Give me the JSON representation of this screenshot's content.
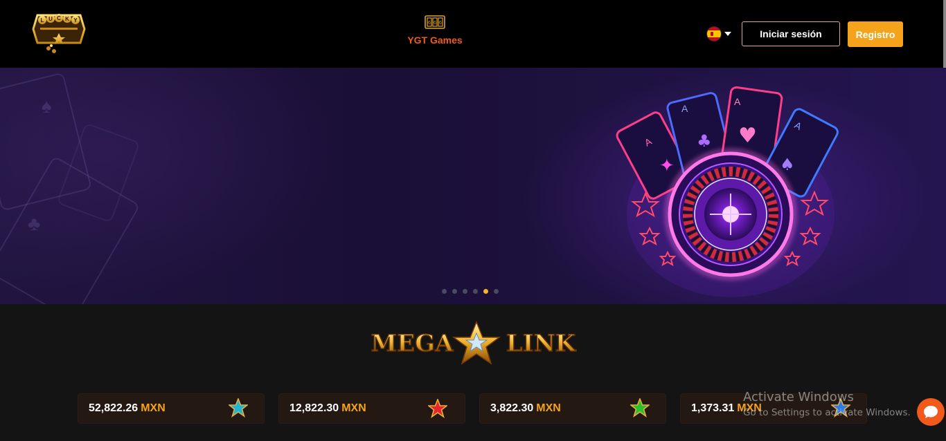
{
  "header": {
    "logo": {
      "text": "LUCKY",
      "alt": "Lucky casino logo"
    },
    "nav_games": {
      "label": "YGT Games",
      "icon": "slot-machine-icon"
    },
    "language": {
      "flag": "spain-flag-icon",
      "icon": "chevron-down-icon"
    },
    "login_label": "Iniciar sesión",
    "register_label": "Registro",
    "colors": {
      "accent": "#f5a31a",
      "nav": "#f15a1e"
    }
  },
  "banner": {
    "slides_total": 6,
    "active_slide": 5,
    "hero_art": "neon-roulette-cards-illustration"
  },
  "jackpots": {
    "logo_text": "MEGA LINK",
    "items": [
      {
        "amount": "52,822.26",
        "currency": "MXN",
        "star_color": "#1bb5d6"
      },
      {
        "amount": "12,822.30",
        "currency": "MXN",
        "star_color": "#e8252d"
      },
      {
        "amount": "3,822.30",
        "currency": "MXN",
        "star_color": "#2bbf2b"
      },
      {
        "amount": "1,373.31",
        "currency": "MXN",
        "star_color": "#2b7ce8"
      }
    ]
  },
  "watermark": {
    "line1": "Activate Windows",
    "line2": "Go to Settings to activate Windows."
  },
  "chat": {
    "icon": "chat-bubble-icon"
  }
}
